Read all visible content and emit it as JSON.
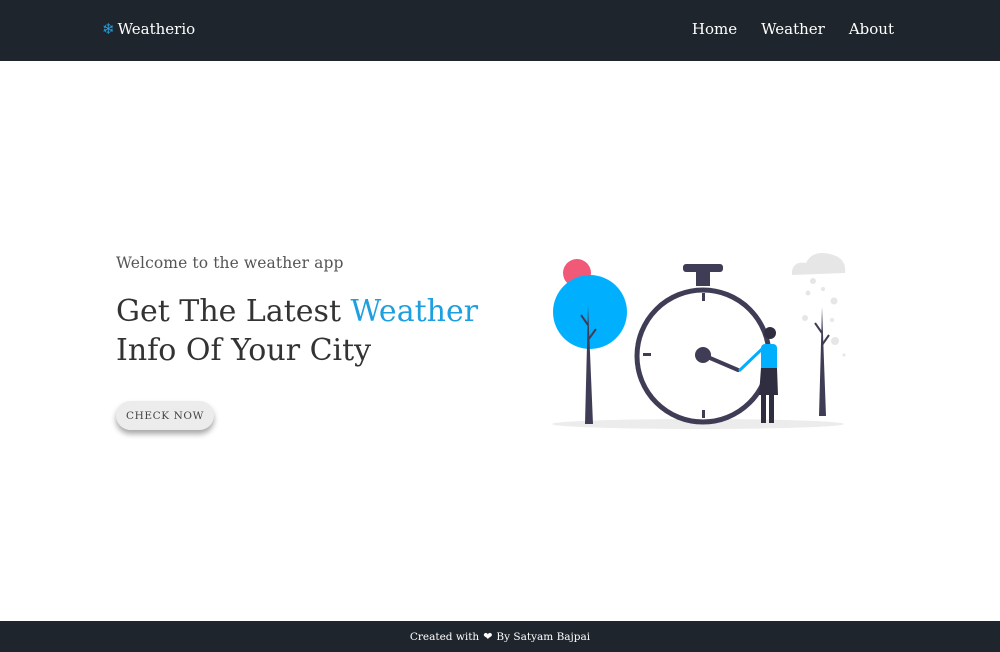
{
  "navbar": {
    "brand": "Weatherio",
    "brand_icon": "snowflake-icon",
    "links": [
      "Home",
      "Weather",
      "About"
    ]
  },
  "hero": {
    "welcome": "Welcome to the weather app",
    "headline_part1": "Get The Latest ",
    "headline_accent": "Weather",
    "headline_part2": "Info Of Your City",
    "button": "CHECK NOW",
    "illustration": "clock-and-woman-illustration"
  },
  "footer": {
    "prefix": "Created with",
    "heart_icon": "heart-icon",
    "suffix": "By Satyam Bajpai"
  },
  "colors": {
    "navbar_bg": "#1f252c",
    "accent": "#1e9fe0",
    "illustration_dark": "#3f3d56",
    "illustration_blue": "#00b0ff",
    "illustration_pink": "#f05a78"
  }
}
